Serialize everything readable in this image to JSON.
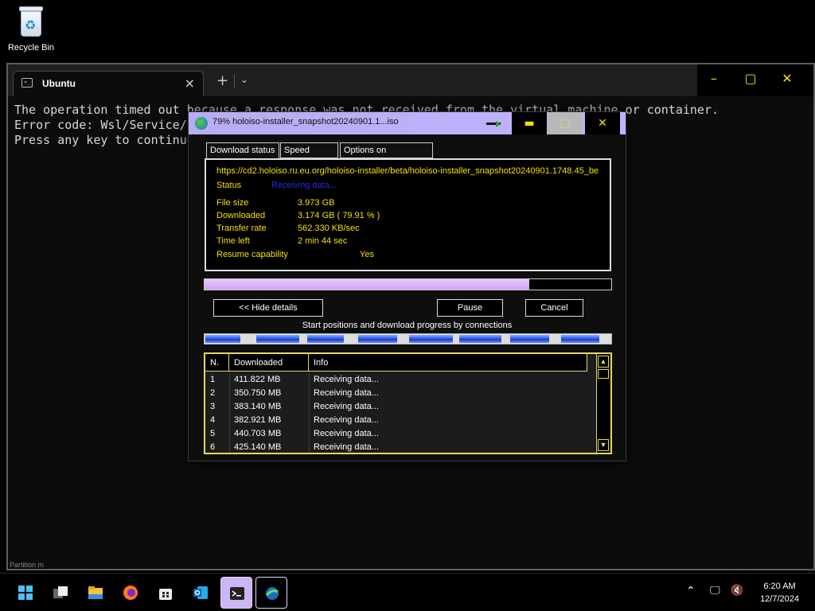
{
  "desktop": {
    "recycle_bin_label": "Recycle Bin"
  },
  "terminal": {
    "tab_title": "Ubuntu",
    "lines": [
      "The operation timed out because a response was not received from the virtual machine or container.",
      "Error code: Wsl/Service/CreateInstance/HCS_E_CONNECTION_TIMEOUT",
      "Press any key to continue..."
    ],
    "footer_text": "Partition m"
  },
  "download_dialog": {
    "title": "79% holoiso-installer_snapshot20240901.1...iso",
    "tabs": [
      "Download status",
      "Speed Limiter",
      "Options on completion"
    ],
    "url": "https://cd2.holoiso.ru.eu.org/holoiso-installer/beta/holoiso-installer_snapshot20240901.1748.45_be",
    "status_label": "Status",
    "status_value": "Receiving data...",
    "fields": [
      {
        "label": "File size",
        "value": "3.973  GB"
      },
      {
        "label": "Downloaded",
        "value": "3.174  GB  ( 79.91 % )"
      },
      {
        "label": "Transfer rate",
        "value": "562.330  KB/sec"
      },
      {
        "label": "Time left",
        "value": "2 min 44 sec"
      }
    ],
    "resume_label": "Resume capability",
    "resume_value": "Yes",
    "progress_fraction": 0.7991,
    "buttons": {
      "hide_details": "<< Hide details",
      "pause": "Pause",
      "cancel": "Cancel"
    },
    "connections_label": "Start positions and download progress by connections",
    "connections_progress": [
      0.72,
      0.88,
      0.75,
      0.8,
      0.9,
      0.85,
      0.8,
      0.78
    ],
    "grid": {
      "columns": [
        "N.",
        "Downloaded",
        "Info"
      ],
      "rows": [
        {
          "n": "1",
          "downloaded": "411.822  MB",
          "info": "Receiving data..."
        },
        {
          "n": "2",
          "downloaded": "350.750  MB",
          "info": "Receiving data..."
        },
        {
          "n": "3",
          "downloaded": "383.140  MB",
          "info": "Receiving data..."
        },
        {
          "n": "4",
          "downloaded": "382.921  MB",
          "info": "Receiving data..."
        },
        {
          "n": "5",
          "downloaded": "440.703  MB",
          "info": "Receiving data..."
        },
        {
          "n": "6",
          "downloaded": "425.140  MB",
          "info": "Receiving data..."
        }
      ]
    }
  },
  "taskbar": {
    "apps": [
      "start-icon",
      "task-view-icon",
      "file-explorer-icon",
      "firefox-icon",
      "store-icon",
      "outlook-icon",
      "terminal-icon",
      "download-manager-icon"
    ],
    "clock_time": "6:20 AM",
    "clock_date": "12/7/2024"
  }
}
